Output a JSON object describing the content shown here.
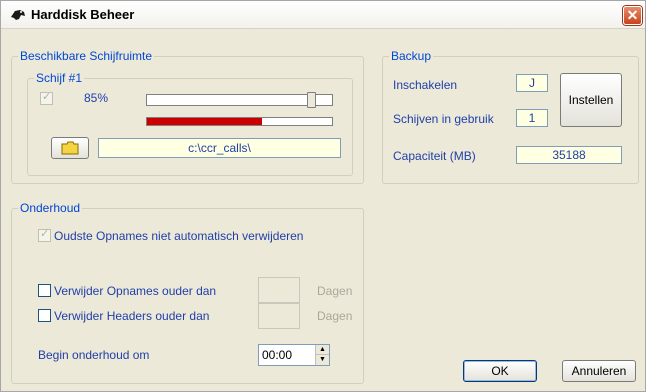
{
  "window": {
    "title": "Harddisk Beheer",
    "close_glyph": "✕"
  },
  "space": {
    "group_label": "Beschikbare Schijfruimte",
    "disk": {
      "label": "Schijf #1",
      "checked": true,
      "percent_label": "85%",
      "slider_value": 0.85,
      "usage_fraction": 0.62,
      "usage_color": "#cc0000",
      "path": "c:\\ccr_calls\\"
    }
  },
  "backup": {
    "group_label": "Backup",
    "enable_label": "Inschakelen",
    "enable_value": "J",
    "disks_label": "Schijven in gebruik",
    "disks_value": "1",
    "settings_button": "Instellen",
    "capacity_label": "Capaciteit (MB)",
    "capacity_value": "35188"
  },
  "maintenance": {
    "group_label": "Onderhoud",
    "oldest_label": "Oudste Opnames niet automatisch verwijderen",
    "oldest_checked": true,
    "delete_recordings_label": "Verwijder Opnames ouder dan",
    "delete_recordings_checked": false,
    "delete_recordings_days": "",
    "delete_headers_label": "Verwijder Headers ouder dan",
    "delete_headers_checked": false,
    "delete_headers_days": "",
    "days_label": "Dagen",
    "start_label": "Begin onderhoud om",
    "start_time": "00:00"
  },
  "buttons": {
    "ok": "OK",
    "cancel": "Annuleren"
  },
  "colors": {
    "label_blue": "#1f3fa8",
    "group_blue": "#0046d5",
    "field_yellow": "#ffffe1"
  }
}
